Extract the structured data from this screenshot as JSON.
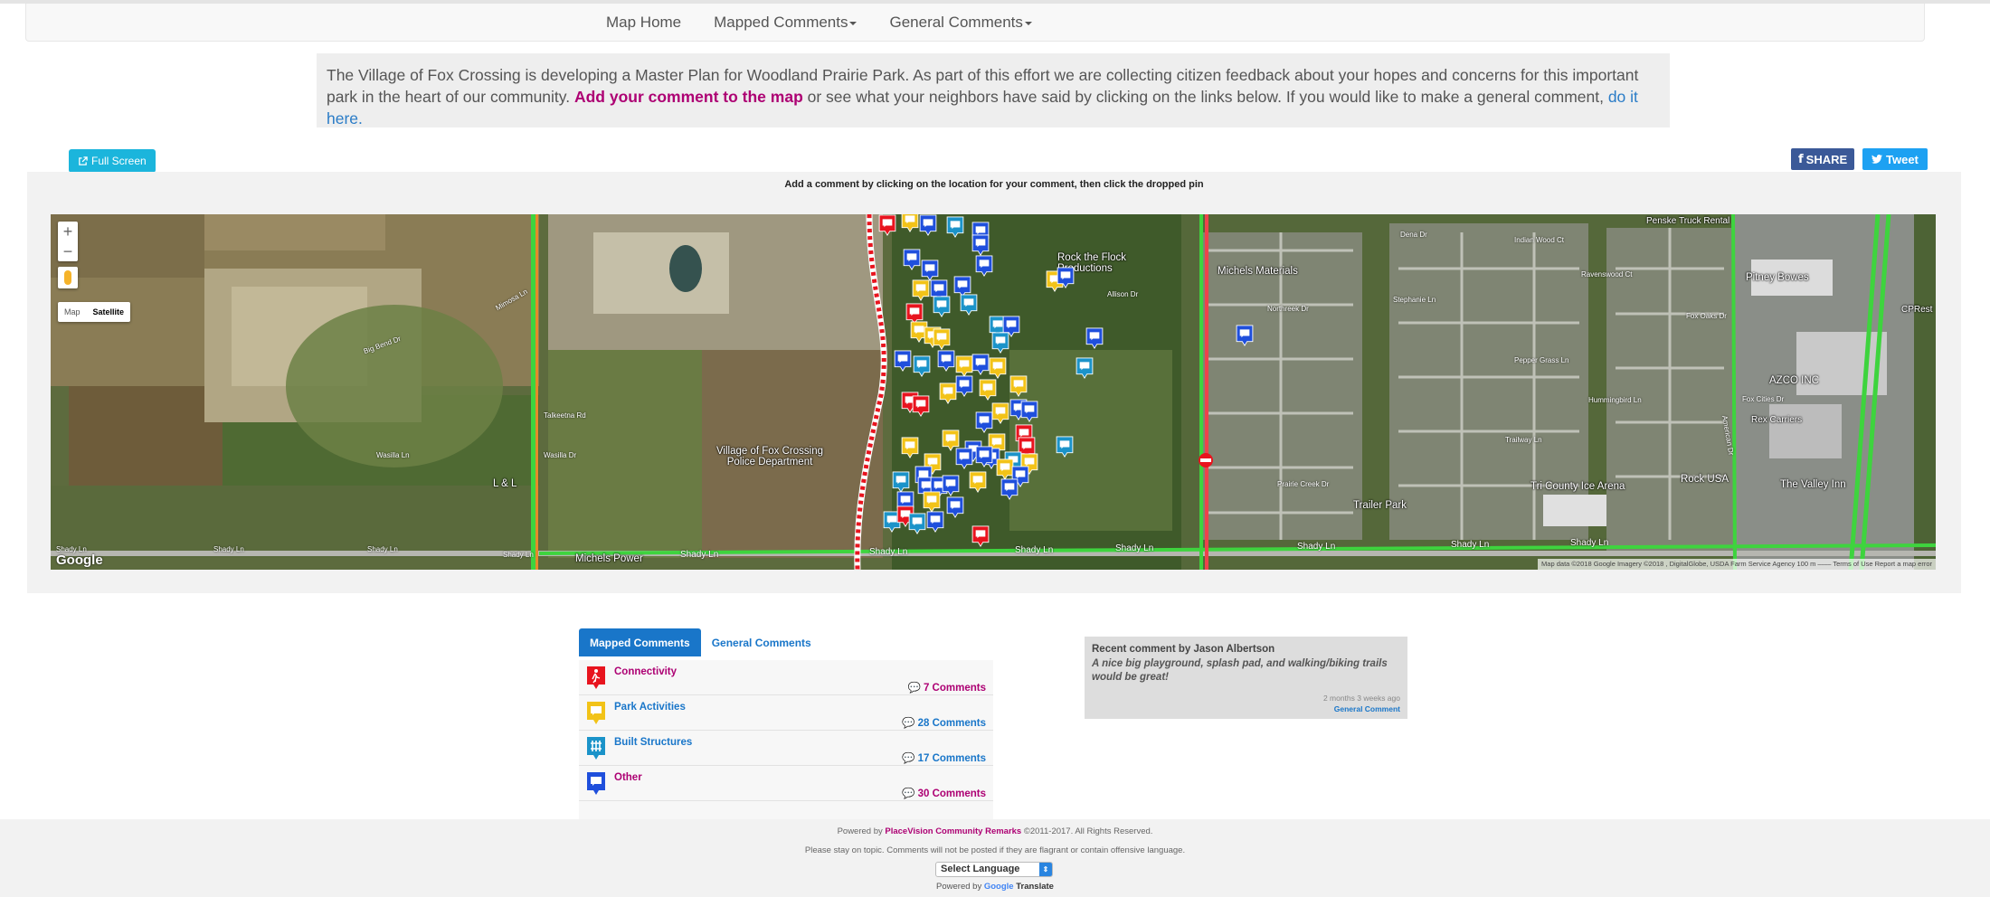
{
  "nav": {
    "items": [
      {
        "label": "Map Home",
        "dropdown": false
      },
      {
        "label": "Mapped Comments",
        "dropdown": true
      },
      {
        "label": "General Comments",
        "dropdown": true
      }
    ]
  },
  "intro": {
    "text_before": "The Village of Fox Crossing is developing a Master Plan for Woodland Prairie Park. As part of this effort we are collecting citizen feedback about your hopes and concerns for this important park in the heart of our community. ",
    "add_link": "Add your comment to the map",
    "text_middle": " or see what your neighbors have said by clicking on the links below. If you would like to make a general comment, ",
    "general_link": "do it here."
  },
  "toolbar": {
    "full_screen": "Full Screen",
    "share": "SHARE",
    "tweet": "Tweet"
  },
  "map": {
    "instruction": "Add a comment by clicking on the location for your comment, then click the dropped pin",
    "zoom_in": "+",
    "zoom_out": "−",
    "map_type": [
      "Map",
      "Satellite"
    ],
    "map_type_selected": "Satellite",
    "logo": "Google",
    "attribution": "Map data ©2018 Google Imagery ©2018 , DigitalGlobe, USDA Farm Service Agency   100 m ⎯⎯⎯⎯   Terms of Use   Report a map error",
    "places": {
      "penske": "Penske Truck Rental",
      "rock": "Rock the Flock Productions",
      "michels_materials": "Michels Materials",
      "pitney": "Pitney Bowes",
      "cprest": "CPRest",
      "azco": "AZCO INC",
      "rex": "Rex Carriers",
      "police": "Village of Fox Crossing Police Department",
      "ll": "L & L",
      "trailer_park": "Trailer Park",
      "tri_county": "Tri County Ice Arena",
      "rock_usa": "Rock USA",
      "valley_inn": "The Valley Inn",
      "michels_power": "Michels Power"
    },
    "streets": {
      "shady1": "Shady Ln",
      "shady2": "Shady Ln",
      "shady3": "Shady Ln",
      "shady4": "Shady Ln",
      "shady5": "Shady Ln",
      "shady6": "Shady Ln",
      "shady7": "Shady Ln",
      "shady8": "Shady Ln",
      "shady9": "Shady Ln",
      "shady10": "Shady Ln",
      "shady11": "Shady Ln",
      "mimosa": "Mimosa Ln",
      "talkestna": "Talkeetna Rd",
      "wasilla": "Wasilla Dr",
      "vasilla": "Wasilla Ln",
      "big_bend": "Big Bend Dr",
      "allison": "Allison Dr",
      "northreek": "Northreek Dr",
      "stephanie": "Stephanie Ln",
      "dena": "Dena Dr",
      "indian_wood": "Indian Wood Ct",
      "ravenswood": "Ravenswood Ct",
      "fox_oaks": "Fox Oaks Dr",
      "pepper_grass": "Pepper Grass Ln",
      "hummingbird": "Hummingbird Ln",
      "trailway": "Trailway Ln",
      "prairie_creek": "Prairie Creek Dr",
      "fox_cities": "Fox Cities Dr",
      "american": "American Dr"
    }
  },
  "tabs": {
    "mapped": "Mapped Comments",
    "general": "General Comments"
  },
  "categories": [
    {
      "name": "Connectivity",
      "count": "7 Comments",
      "color": "#e8141e",
      "style": "magenta"
    },
    {
      "name": "Park Activities",
      "count": "28 Comments",
      "color": "#f2c318",
      "style": "blue"
    },
    {
      "name": "Built Structures",
      "count": "17 Comments",
      "color": "#1b93c9",
      "style": "blue"
    },
    {
      "name": "Other",
      "count": "30 Comments",
      "color": "#1f4fdc",
      "style": "magenta"
    }
  ],
  "recent": {
    "header": "Recent comment by Jason Albertson",
    "message": "A nice big playground, splash pad, and walking/biking trails would be great!",
    "ago": "2 months 3 weeks ago",
    "type": "General Comment"
  },
  "footer": {
    "powered_prefix": "Powered by ",
    "powered_link": "PlaceVision Community Remarks",
    "powered_suffix": " ©2011-2017. All Rights Reserved.",
    "ontopic": "Please stay on topic. Comments will not be posted if they are flagrant or contain offensive language.",
    "select_language": "Select Language",
    "gt_prefix": "Powered by ",
    "gt_google": "Google",
    "gt_translate": " Translate"
  },
  "colors": {
    "accent": "#1976c9",
    "brand_magenta": "#ad0073",
    "facebook": "#3b5998",
    "twitter": "#1da1f2",
    "fullscreen": "#1bb5dc"
  },
  "icons": {
    "external_link": "external-link-icon",
    "facebook": "facebook-icon",
    "twitter": "twitter-icon",
    "comments": "comments-icon"
  }
}
